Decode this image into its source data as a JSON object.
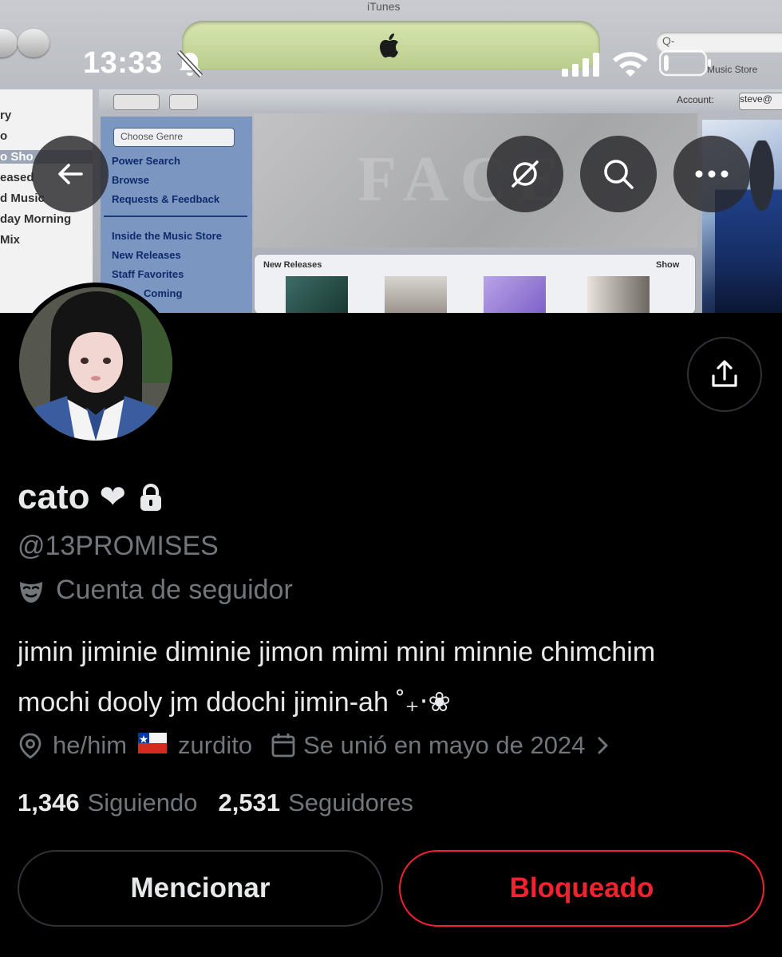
{
  "banner": {
    "window_title": "iTunes",
    "sidebar_items": [
      "ry",
      "o",
      "o Sho",
      "eased",
      "d Music",
      "day Morning",
      "Mix"
    ],
    "nav": {
      "account_label": "Account:",
      "account_value": "steve@"
    },
    "store_search_placeholder": "Q-",
    "music_store_label": "Music Store",
    "store_sidebar": {
      "genre_select": "Choose Genre",
      "links_top": [
        "Power Search",
        "Browse",
        "Requests & Feedback"
      ],
      "links_bottom": [
        "Inside the Music Store",
        "New Releases",
        "Staff Favorites",
        "Coming"
      ]
    },
    "feature_word": "FACE",
    "new_releases": {
      "header": "New Releases",
      "show_all": "Show"
    }
  },
  "status_bar": {
    "time": "13:33",
    "bell_icon": "bell-slash-icon",
    "signal_icon": "cellular-signal-icon",
    "wifi_icon": "wifi-icon",
    "battery_icon": "battery-low-icon",
    "battery_level": 0.12
  },
  "top_actions": {
    "back_icon": "arrow-left-icon",
    "grok_icon": "grok-icon",
    "search_icon": "search-icon",
    "more_icon": "more-horizontal-icon"
  },
  "profile": {
    "display_name": "cato",
    "name_emoji": "❤",
    "lock_icon": "lock-icon",
    "handle": "@13PROMISES",
    "parody_label": "Cuenta de seguidor",
    "parody_icon": "mask-icon",
    "bio_line1": "jimin jiminie diminie jimon mimi mini minnie chimchim",
    "bio_line2": "mochi dooly jm ddochi jimin-ah ˚₊‧❀",
    "pronouns": "he/him",
    "flag": "🇨🇱",
    "flag_icon": "chile-flag-icon",
    "location_extra": "zurdito",
    "joined": "Se unió en mayo de 2024",
    "following_count": "1,346",
    "following_label": "Siguiendo",
    "followers_count": "2,531",
    "followers_label": "Seguidores"
  },
  "buttons": {
    "mention": "Mencionar",
    "blocked": "Bloqueado"
  },
  "colors": {
    "background": "#000000",
    "text_primary": "#e7e9ea",
    "text_secondary": "#71767b",
    "danger": "#f4212e",
    "border": "#2f3336"
  }
}
